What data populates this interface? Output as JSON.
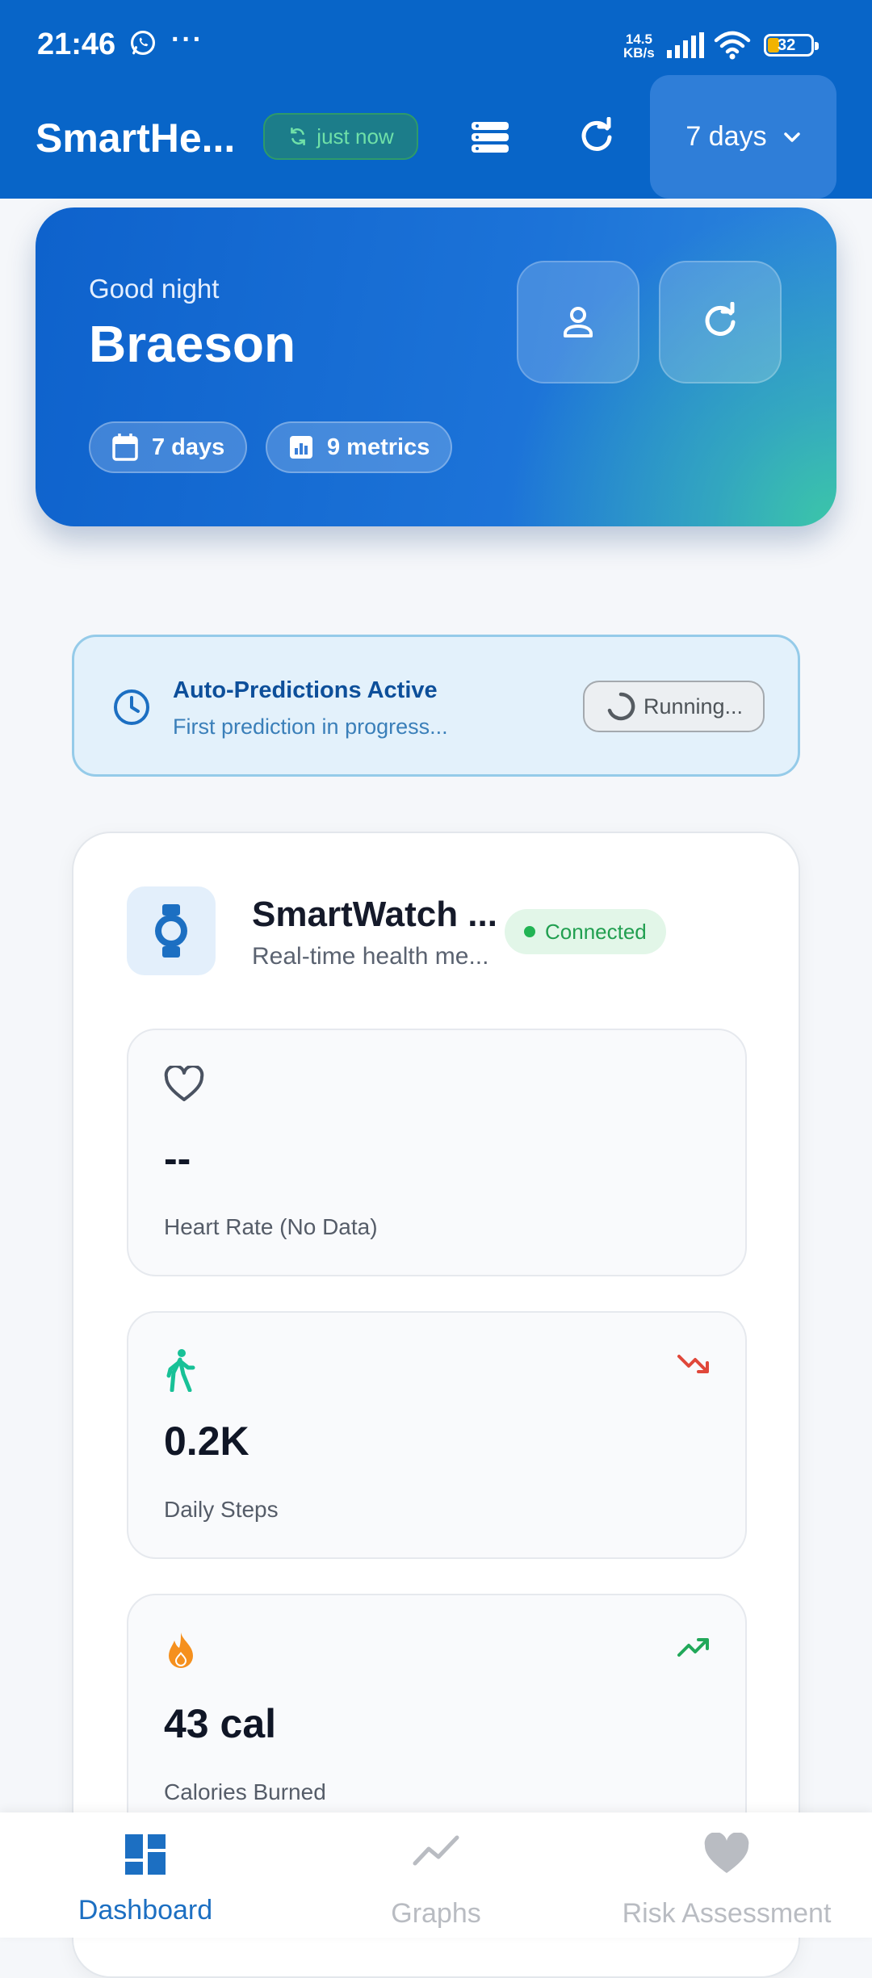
{
  "status_bar": {
    "time": "21:46",
    "net_speed_value": "14.5",
    "net_speed_unit": "KB/s",
    "battery": "32"
  },
  "app_bar": {
    "title": "SmartHe...",
    "sync_label": "just now",
    "range_selected": "7 days"
  },
  "hero": {
    "greeting": "Good night",
    "user_name": "Braeson",
    "chip_days": "7 days",
    "chip_metrics": "9 metrics"
  },
  "predictions": {
    "title": "Auto-Predictions Active",
    "subtitle": "First prediction in progress...",
    "status_button": "Running..."
  },
  "device": {
    "title": "SmartWatch ...",
    "subtitle": "Real-time health me...",
    "status": "Connected",
    "metrics": [
      {
        "value": "--",
        "label": "Heart Rate (No Data)",
        "icon": "heart-outline-icon",
        "trend": "none"
      },
      {
        "value": "0.2K",
        "label": "Daily Steps",
        "icon": "walking-icon",
        "trend": "down"
      },
      {
        "value": "43 cal",
        "label": "Calories Burned",
        "icon": "flame-icon",
        "trend": "up"
      }
    ]
  },
  "bottom_nav": {
    "items": [
      {
        "label": "Dashboard",
        "icon": "dashboard-icon",
        "active": true
      },
      {
        "label": "Graphs",
        "icon": "graph-icon",
        "active": false
      },
      {
        "label": "Risk Assessment",
        "icon": "heart-icon",
        "active": false
      }
    ]
  },
  "colors": {
    "primary": "#0865c8",
    "accent_teal": "#3bc6a8",
    "success": "#22b454",
    "trend_down": "#e0473a",
    "trend_up": "#22a85a",
    "nav_active": "#1c6fc2",
    "nav_inactive": "#b9bcc2"
  }
}
